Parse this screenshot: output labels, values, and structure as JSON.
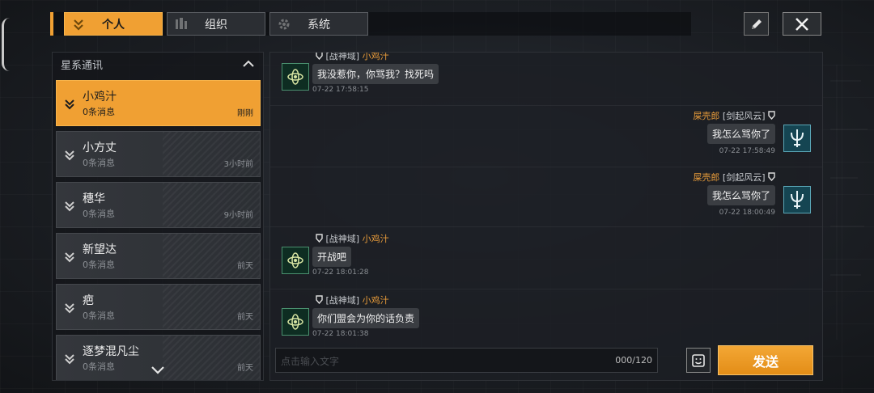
{
  "tabs": [
    {
      "label": "个人",
      "icon": "download-arrow-icon",
      "active": true
    },
    {
      "label": "组织",
      "icon": "building-icon",
      "active": false
    },
    {
      "label": "系统",
      "icon": "gear-icon",
      "active": false
    }
  ],
  "left_panel": {
    "title": "星系通讯",
    "contacts": [
      {
        "name": "小鸡汁",
        "messages": "0条消息",
        "time": "刚刚",
        "active": true
      },
      {
        "name": "小方丈",
        "messages": "0条消息",
        "time": "3小时前"
      },
      {
        "name": "穗华",
        "messages": "0条消息",
        "time": "9小时前"
      },
      {
        "name": "新望达",
        "messages": "0条消息",
        "time": "前天"
      },
      {
        "name": "疤",
        "messages": "0条消息",
        "time": "前天"
      },
      {
        "name": "逐梦混凡尘",
        "messages": "0条消息",
        "time": "前天"
      }
    ]
  },
  "chat": {
    "messages": [
      {
        "side": "left",
        "tag": "[战神域]",
        "name": "小鸡汁",
        "text": "我没惹你，你骂我？找死吗",
        "time": "07-22 17:58:15"
      },
      {
        "side": "right",
        "name": "屎壳郎",
        "tag": "[剑起风云]",
        "text": "我怎么骂你了",
        "time": "07-22 17:58:49"
      },
      {
        "side": "right",
        "name": "屎壳郎",
        "tag": "[剑起风云]",
        "text": "我怎么骂你了",
        "time": "07-22 18:00:49"
      },
      {
        "side": "left",
        "tag": "[战神域]",
        "name": "小鸡汁",
        "text": "开战吧",
        "time": "07-22 18:01:28"
      },
      {
        "side": "left",
        "tag": "[战神域]",
        "name": "小鸡汁",
        "text": "你们盟会为你的话负责",
        "time": "07-22 18:01:38"
      }
    ]
  },
  "input": {
    "placeholder": "点击输入文字",
    "counter": "000/120"
  },
  "send_label": "发送",
  "colors": {
    "accent": "#f0a033",
    "sender_name": "#e79b3a",
    "panel": "#1c1f24"
  }
}
